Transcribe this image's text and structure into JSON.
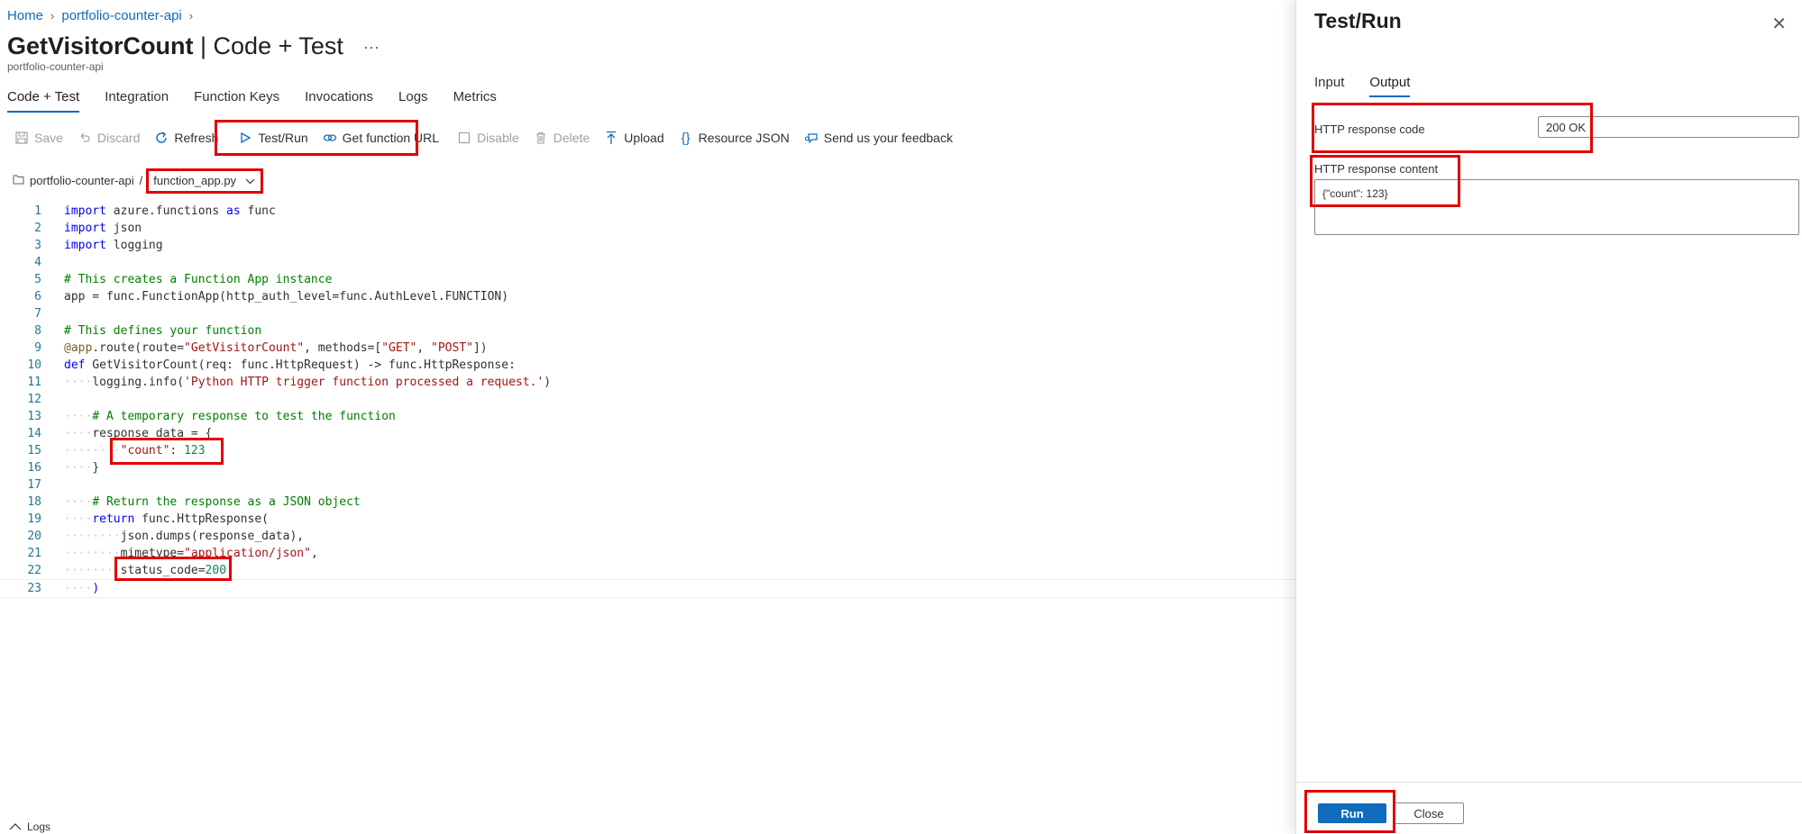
{
  "breadcrumb": {
    "home": "Home",
    "item": "portfolio-counter-api"
  },
  "header": {
    "title_bold": "GetVisitorCount",
    "title_rest": " | Code + Test",
    "more": "···",
    "subtitle": "portfolio-counter-api"
  },
  "tabs": [
    {
      "label": "Code + Test",
      "active": true
    },
    {
      "label": "Integration"
    },
    {
      "label": "Function Keys"
    },
    {
      "label": "Invocations"
    },
    {
      "label": "Logs"
    },
    {
      "label": "Metrics"
    }
  ],
  "toolbar": {
    "save": "Save",
    "discard": "Discard",
    "refresh": "Refresh",
    "test_run": "Test/Run",
    "get_url": "Get function URL",
    "disable": "Disable",
    "delete": "Delete",
    "upload": "Upload",
    "resource_json": "Resource JSON",
    "feedback": "Send us your feedback"
  },
  "filepath": {
    "folder": "portfolio-counter-api",
    "separator": "/",
    "file": "function_app.py"
  },
  "code": {
    "line_numbers": [
      "1",
      "2",
      "3",
      "4",
      "5",
      "6",
      "7",
      "8",
      "9",
      "10",
      "11",
      "12",
      "13",
      "14",
      "15",
      "16",
      "17",
      "18",
      "19",
      "20",
      "21",
      "22",
      "23"
    ],
    "l1": {
      "k1": "import",
      "t": " azure.functions ",
      "k2": "as",
      "t2": " func"
    },
    "l2": {
      "k": "import",
      "t": " json"
    },
    "l3": {
      "k": "import",
      "t": " logging"
    },
    "l5": "# This creates a Function App instance",
    "l6": "app = func.FunctionApp(http_auth_level=func.AuthLevel.FUNCTION)",
    "l8": "# This defines your function",
    "l9": {
      "dec": "@app",
      "a": ".route(route=",
      "s1": "\"GetVisitorCount\"",
      "b": ", methods=[",
      "s2": "\"GET\"",
      "c": ", ",
      "s3": "\"POST\"",
      "d": "])"
    },
    "l10": {
      "k": "def",
      "t": " GetVisitorCount(req: func.HttpRequest) -> func.HttpResponse:"
    },
    "l11": {
      "a": "logging.info(",
      "s": "'Python HTTP trigger function processed a request.'",
      "b": ")"
    },
    "l13": "# A temporary response to test the function",
    "l14": "response_data = {",
    "l15": {
      "s": "\"count\"",
      "a": ": ",
      "n": "123"
    },
    "l16": "}",
    "l18": "# Return the response as a JSON object",
    "l19": {
      "k": "return",
      "t": " func.HttpResponse("
    },
    "l20": "json.dumps(response_data),",
    "l21": {
      "a": "mimetype=",
      "s": "\"application/json\"",
      "b": ","
    },
    "l22": {
      "a": "status_code=",
      "n": "200"
    },
    "l23": ")"
  },
  "logs": {
    "label": "Logs"
  },
  "panel": {
    "title": "Test/Run",
    "close_icon": "✕",
    "tabs": [
      {
        "label": "Input"
      },
      {
        "label": "Output",
        "active": true
      }
    ],
    "response_code_label": "HTTP response code",
    "response_code_value": "200 OK",
    "response_content_label": "HTTP response content",
    "response_content_value": "{\"count\": 123}",
    "run": "Run",
    "close": "Close"
  },
  "colors": {
    "accent": "#0f6cbd",
    "highlight_box": "#e00000",
    "keyword": "#0000ff",
    "string": "#a31515",
    "number": "#098658",
    "comment": "#008000"
  }
}
